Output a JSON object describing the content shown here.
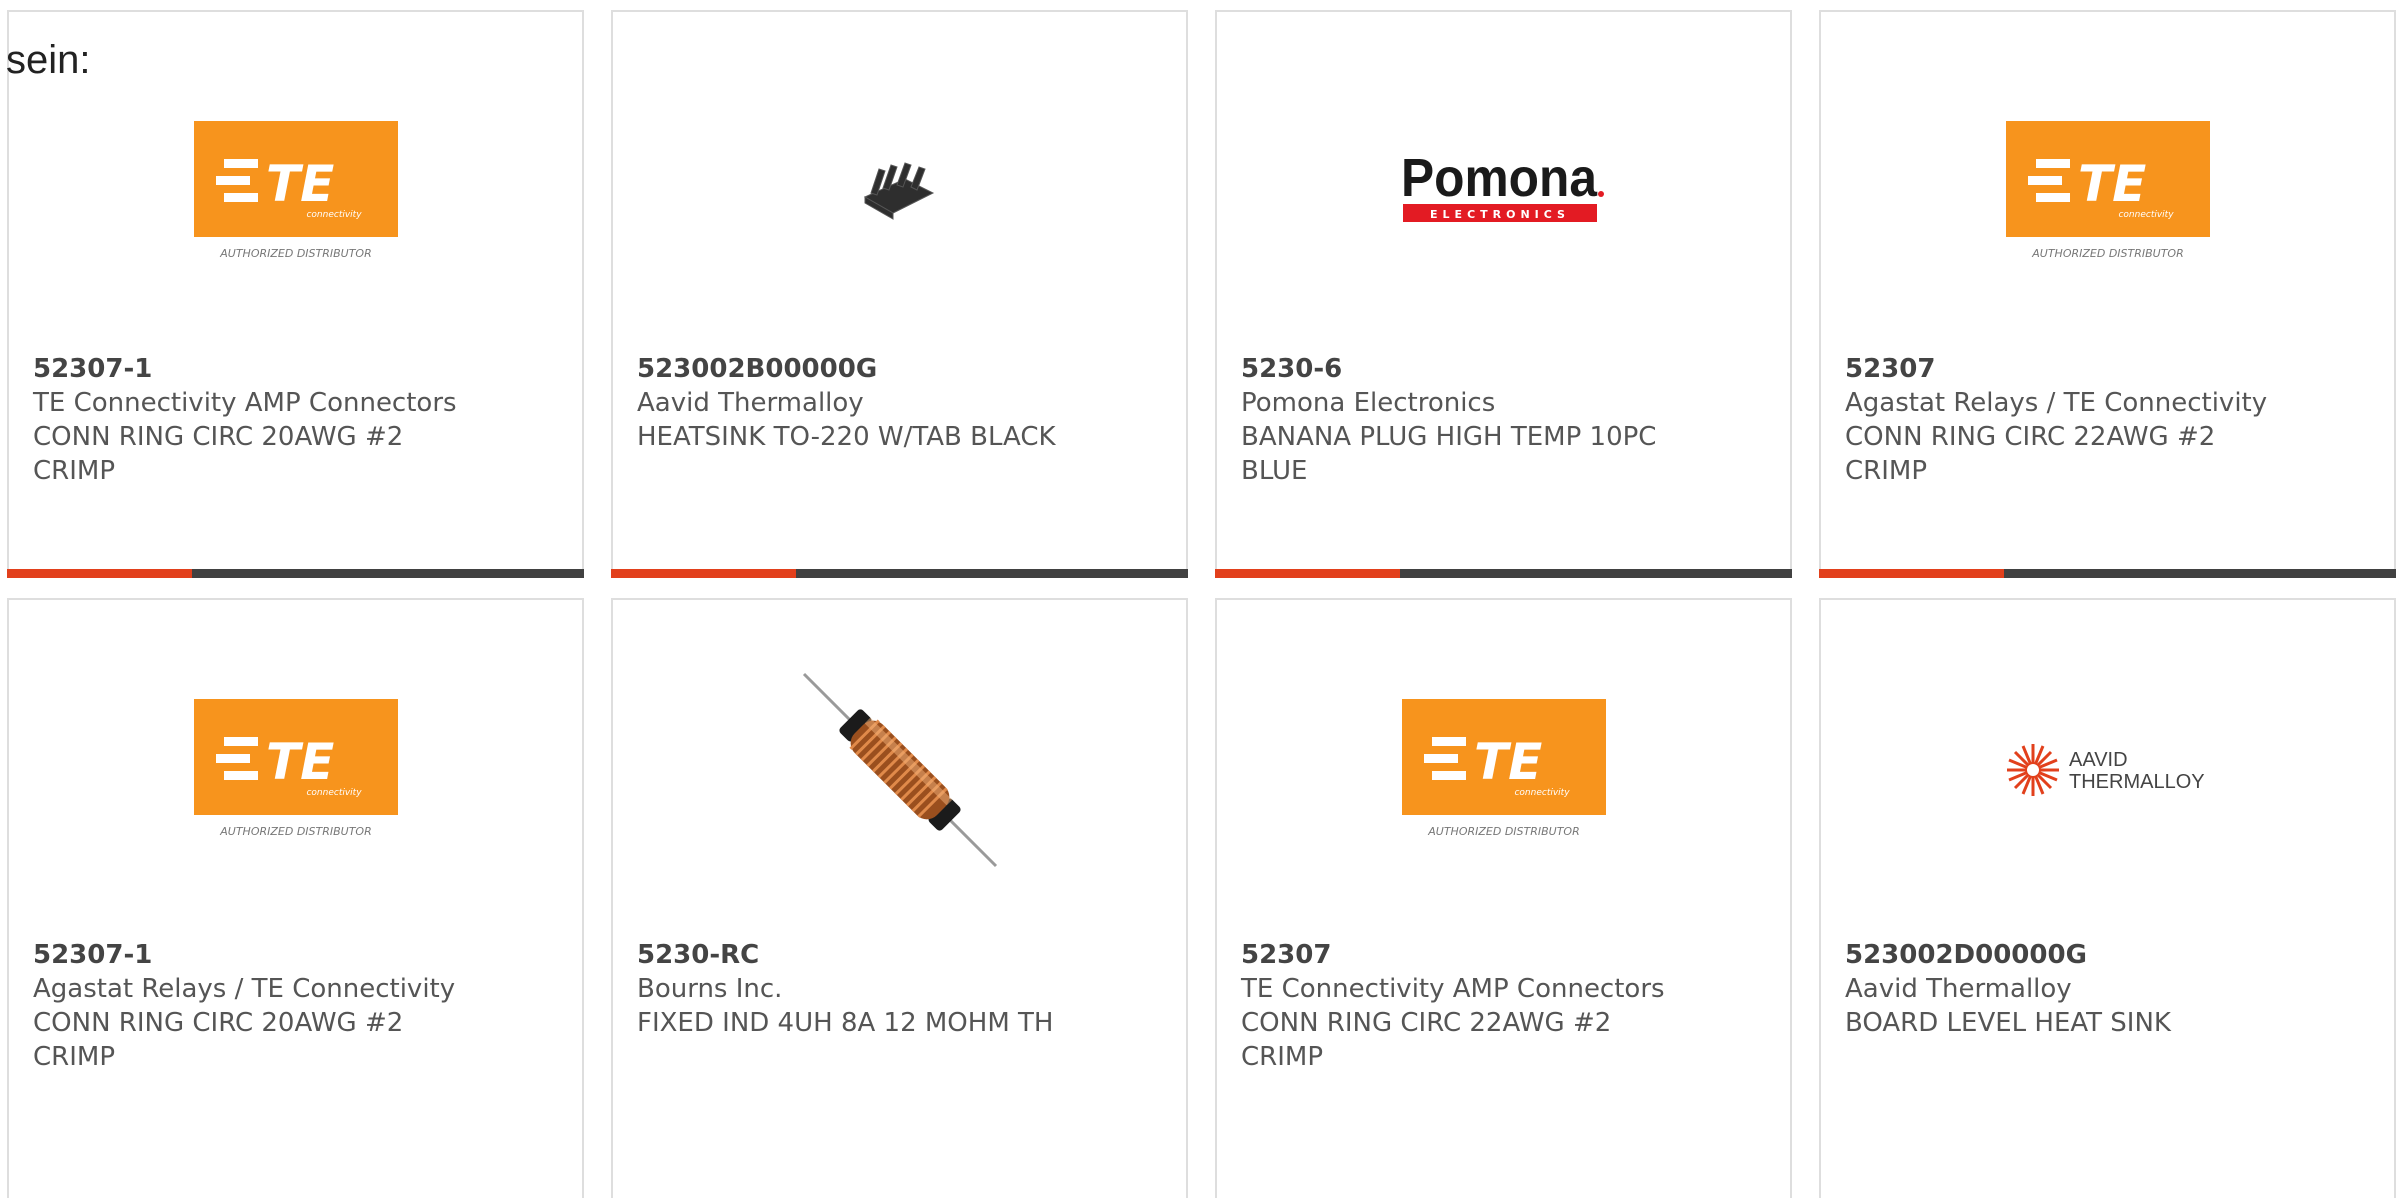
{
  "page": {
    "prefix_text": "sein:"
  },
  "colors": {
    "accent": "#e2401c",
    "bar": "#414141",
    "te_orange": "#f7941d",
    "pomona_red": "#e31b23"
  },
  "cards": [
    {
      "part": "52307-1",
      "manufacturer": "TE Connectivity AMP Connectors",
      "description": "CONN RING CIRC 20AWG #2 CRIMP",
      "image": "te-connectivity-logo",
      "logo": {
        "mark": "TE",
        "sub": "connectivity",
        "caption": "AUTHORIZED DISTRIBUTOR"
      }
    },
    {
      "part": "523002B00000G",
      "manufacturer": "Aavid Thermalloy",
      "description": "HEATSINK TO-220 W/TAB BLACK",
      "image": "heatsink-photo"
    },
    {
      "part": "5230-6",
      "manufacturer": "Pomona Electronics",
      "description": "BANANA PLUG HIGH TEMP 10PC BLUE",
      "image": "pomona-logo",
      "logo": {
        "mark": "Pomona",
        "sub": "ELECTRONICS"
      }
    },
    {
      "part": "52307",
      "manufacturer": "Agastat Relays / TE Connectivity",
      "description": "CONN RING CIRC 22AWG #2 CRIMP",
      "image": "te-connectivity-logo",
      "logo": {
        "mark": "TE",
        "sub": "connectivity",
        "caption": "AUTHORIZED DISTRIBUTOR"
      }
    },
    {
      "part": "52307-1",
      "manufacturer": "Agastat Relays / TE Connectivity",
      "description": "CONN RING CIRC 20AWG #2 CRIMP",
      "image": "te-connectivity-logo",
      "logo": {
        "mark": "TE",
        "sub": "connectivity",
        "caption": "AUTHORIZED DISTRIBUTOR"
      }
    },
    {
      "part": "5230-RC",
      "manufacturer": "Bourns Inc.",
      "description": "FIXED IND 4UH 8A 12 MOHM TH",
      "image": "inductor-photo"
    },
    {
      "part": "52307",
      "manufacturer": "TE Connectivity AMP Connectors",
      "description": "CONN RING CIRC 22AWG #2 CRIMP",
      "image": "te-connectivity-logo",
      "logo": {
        "mark": "TE",
        "sub": "connectivity",
        "caption": "AUTHORIZED DISTRIBUTOR"
      }
    },
    {
      "part": "523002D00000G",
      "manufacturer": "Aavid Thermalloy",
      "description": "BOARD LEVEL HEAT SINK",
      "image": "aavid-thermalloy-logo",
      "logo": {
        "line1": "AAVID",
        "line2": "THERMALLOY"
      }
    }
  ]
}
